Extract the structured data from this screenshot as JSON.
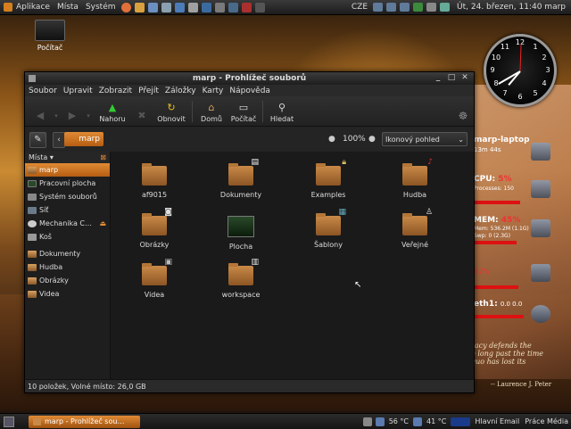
{
  "top_panel": {
    "menus": [
      "Aplikace",
      "Místa",
      "Systém"
    ],
    "language": "CZE",
    "clock": "Út, 24. březen, 11:40",
    "user": "marp"
  },
  "desktop": {
    "computer_icon_label": "Počítač"
  },
  "analog_clock": {
    "numbers": [
      "12",
      "1",
      "2",
      "3",
      "4",
      "5",
      "6",
      "7",
      "8",
      "9",
      "10",
      "11"
    ]
  },
  "conky": {
    "hostname": "marp-laptop",
    "uptime": "13m 44s",
    "cpu_label": "CPU:",
    "cpu_value": "5%",
    "cpu_proc_line": "Processes: 150",
    "mem_label": "MEM:",
    "mem_value": "45%",
    "mem_line": "Mem: 536.2M (1.1G)",
    "swap_line": "Swp: 0 (2.3G)",
    "disk_value": "67%",
    "net_label": "eth1:",
    "net_value": "0.0  0.0"
  },
  "quote": {
    "text": "racy defends the … long past the time … quo has lost its",
    "line1": "racy defends the",
    "line2": "o long past the time",
    "line3": "quo has lost its",
    "author": "-- Laurence J. Peter"
  },
  "window": {
    "title": "marp - Prohlížeč souborů",
    "menus": [
      "Soubor",
      "Upravit",
      "Zobrazit",
      "Přejít",
      "Záložky",
      "Karty",
      "Nápověda"
    ],
    "toolbar": {
      "back": "",
      "forward": "",
      "up": "Nahoru",
      "stop": "",
      "reload": "Obnovit",
      "home": "Domů",
      "computer": "Počítač",
      "search": "Hledat"
    },
    "location": {
      "current": "marp",
      "zoom": "100%",
      "view_mode": "Ikonový pohled"
    },
    "sidebar": {
      "header": "Místa",
      "places": [
        {
          "label": "marp",
          "selected": true
        },
        {
          "label": "Pracovní plocha"
        },
        {
          "label": "Systém souborů"
        },
        {
          "label": "Síť"
        },
        {
          "label": "Mechanika C…"
        },
        {
          "label": "Koš"
        }
      ],
      "bookmarks": [
        "Dokumenty",
        "Hudba",
        "Obrázky",
        "Videa"
      ]
    },
    "files": [
      {
        "name": "af9015",
        "emblem": ""
      },
      {
        "name": "Dokumenty",
        "emblem": "document-emblem"
      },
      {
        "name": "Examples",
        "emblem": "lock-emblem"
      },
      {
        "name": "Hudba",
        "emblem": "music-emblem"
      },
      {
        "name": "Obrázky",
        "emblem": "camera-emblem"
      },
      {
        "name": "Plocha",
        "emblem": "desktop"
      },
      {
        "name": "Šablony",
        "emblem": "template-emblem"
      },
      {
        "name": "Veřejné",
        "emblem": "people-emblem"
      },
      {
        "name": "Videa",
        "emblem": "film-emblem"
      },
      {
        "name": "workspace",
        "emblem": "clipboard-emblem"
      }
    ],
    "status": "10 položek, Volné místo: 26,0 GB"
  },
  "bottom_panel": {
    "task": "marp - Prohlížeč sou…",
    "temp1": "56 °C",
    "temp2": "41 °C",
    "mail": "Hlavní Email",
    "work": "Práce Média"
  }
}
